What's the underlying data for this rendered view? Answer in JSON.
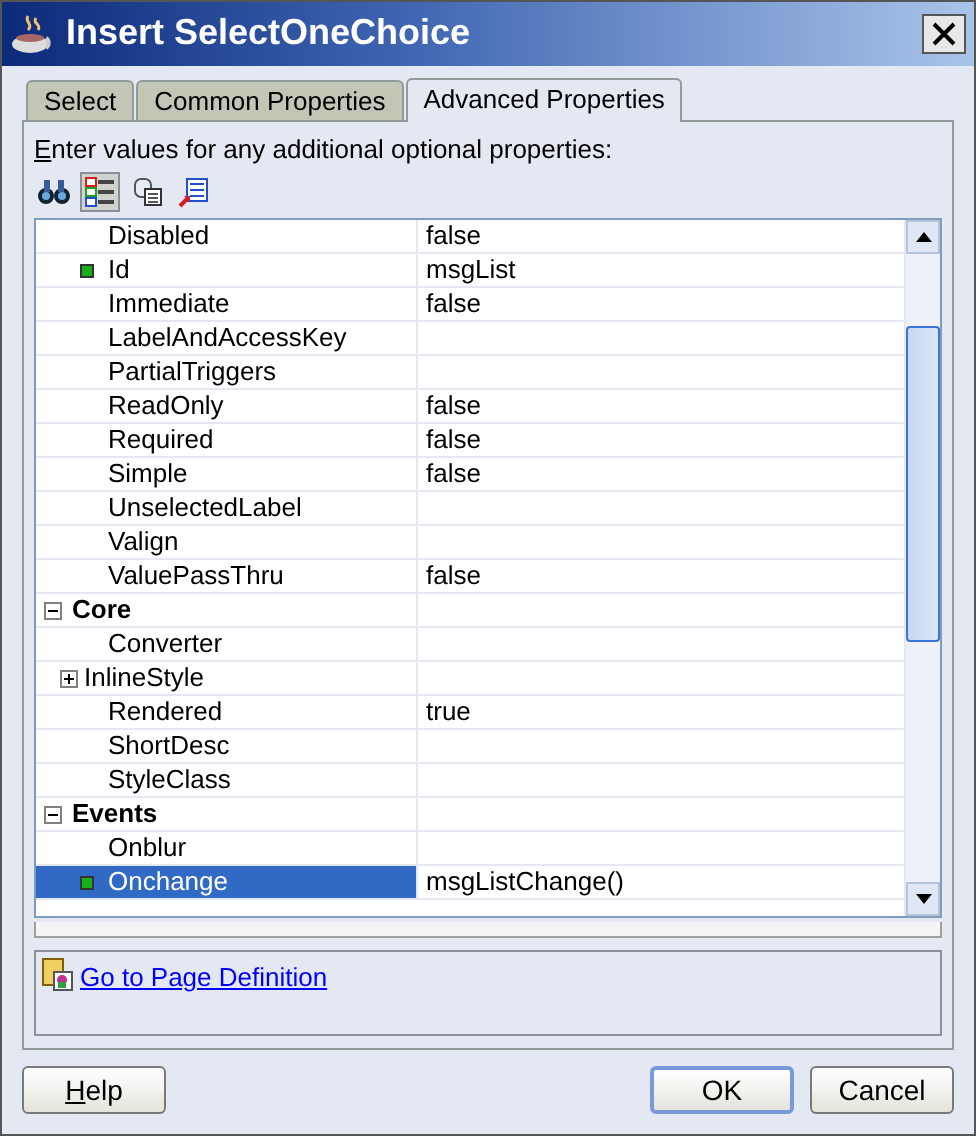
{
  "window": {
    "title": "Insert SelectOneChoice"
  },
  "tabs": [
    {
      "label": "Select",
      "selected": false
    },
    {
      "label": "Common Properties",
      "selected": false
    },
    {
      "label": "Advanced Properties",
      "selected": true
    }
  ],
  "instructions": {
    "text": "Enter values for any additional optional properties:",
    "access_key_underlined": true
  },
  "toolbar": [
    {
      "kind": "find",
      "selected": false
    },
    {
      "kind": "categorized",
      "selected": true
    },
    {
      "kind": "copy",
      "selected": false
    },
    {
      "kind": "edit",
      "selected": false
    }
  ],
  "properties": [
    {
      "kind": "property",
      "name": "Disabled",
      "value": "false",
      "set": false,
      "selected": false
    },
    {
      "kind": "property",
      "name": "Id",
      "value": "msgList",
      "set": true,
      "selected": false
    },
    {
      "kind": "property",
      "name": "Immediate",
      "value": "false",
      "set": false,
      "selected": false
    },
    {
      "kind": "property",
      "name": "LabelAndAccessKey",
      "set": false,
      "selected": false
    },
    {
      "kind": "property",
      "name": "PartialTriggers",
      "set": false,
      "selected": false
    },
    {
      "kind": "property",
      "name": "ReadOnly",
      "value": "false",
      "set": false,
      "selected": false
    },
    {
      "kind": "property",
      "name": "Required",
      "value": "false",
      "set": false,
      "selected": false
    },
    {
      "kind": "property",
      "name": "Simple",
      "value": "false",
      "set": false,
      "selected": false
    },
    {
      "kind": "property",
      "name": "UnselectedLabel",
      "set": false,
      "selected": false
    },
    {
      "kind": "property",
      "name": "Valign",
      "set": false,
      "selected": false
    },
    {
      "kind": "property",
      "name": "ValuePassThru",
      "value": "false",
      "set": false,
      "selected": false
    },
    {
      "kind": "category",
      "name": "Core",
      "expanded": true,
      "selected": false
    },
    {
      "kind": "property",
      "name": "Converter",
      "set": false,
      "selected": false
    },
    {
      "kind": "group",
      "name": "InlineStyle",
      "expanded": false,
      "selected": false
    },
    {
      "kind": "property",
      "name": "Rendered",
      "value": "true",
      "set": false,
      "selected": false
    },
    {
      "kind": "property",
      "name": "ShortDesc",
      "set": false,
      "selected": false
    },
    {
      "kind": "property",
      "name": "StyleClass",
      "set": false,
      "selected": false
    },
    {
      "kind": "category",
      "name": "Events",
      "expanded": true,
      "selected": false
    },
    {
      "kind": "property",
      "name": "Onblur",
      "set": false,
      "selected": false
    },
    {
      "kind": "property",
      "name": "Onchange",
      "value": "msgListChange()",
      "set": true,
      "selected": true
    }
  ],
  "link": {
    "label": "Go to Page Definition"
  },
  "buttons": [
    {
      "label": "Help",
      "access_key_underlined": true,
      "default": false
    },
    {
      "label": "OK",
      "default": true
    },
    {
      "label": "Cancel",
      "default": false
    }
  ]
}
